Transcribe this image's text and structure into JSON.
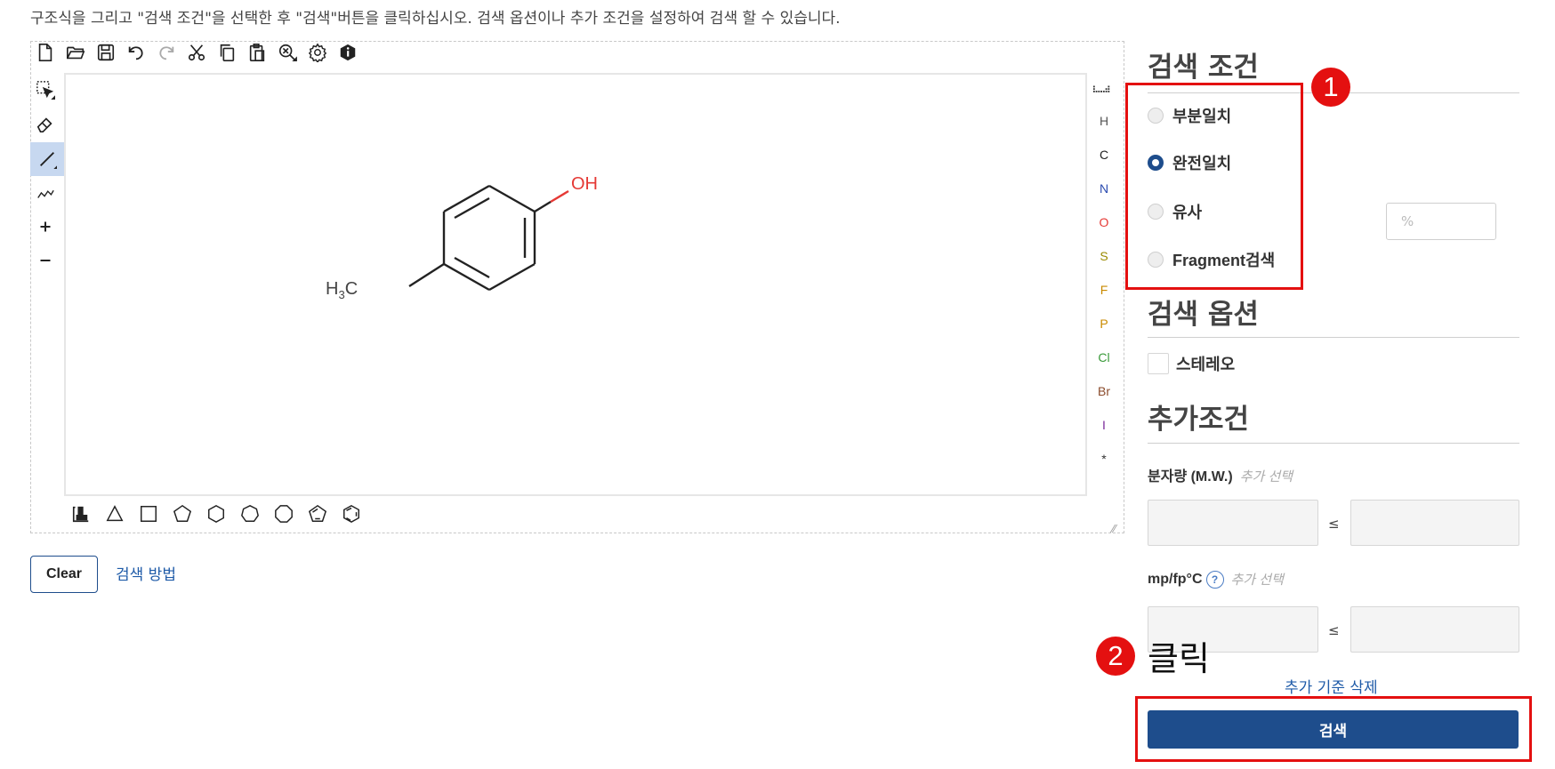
{
  "instruction": "구조식을 그리고 \"검색 조건\"을 선택한 후 \"검색\"버튼을 클릭하십시오. 검색 옵션이나 추가 조건을 설정하여 검색 할 수 있습니다.",
  "toolbar": {
    "top_icons": [
      "new-file-icon",
      "open-folder-icon",
      "save-icon",
      "undo-icon",
      "redo-icon",
      "cut-icon",
      "copy-icon",
      "paste-icon",
      "zoom-icon",
      "settings-icon",
      "info-icon"
    ],
    "left_icons": [
      "select-icon",
      "eraser-icon",
      "bond-icon",
      "chain-icon",
      "plus-icon",
      "minus-icon"
    ],
    "bottom_icons": [
      "template-icon",
      "triangle-icon",
      "square-icon",
      "pentagon-icon",
      "hexagon-icon",
      "heptagon-icon",
      "octagon-icon",
      "cyclopentadiene-icon",
      "benzene-icon"
    ]
  },
  "periodic_icon": "periodic-table-icon",
  "elements": [
    {
      "symbol": "H",
      "color": "#555555"
    },
    {
      "symbol": "C",
      "color": "#222222"
    },
    {
      "symbol": "N",
      "color": "#2b4bb0"
    },
    {
      "symbol": "O",
      "color": "#e53935"
    },
    {
      "symbol": "S",
      "color": "#9a8a00"
    },
    {
      "symbol": "F",
      "color": "#c98a00"
    },
    {
      "symbol": "P",
      "color": "#c98a00"
    },
    {
      "symbol": "Cl",
      "color": "#3a9a3a"
    },
    {
      "symbol": "Br",
      "color": "#8a4a2a"
    },
    {
      "symbol": "I",
      "color": "#7a2a9a"
    },
    {
      "symbol": "*",
      "color": "#333333"
    }
  ],
  "molecule": {
    "oh_label": "OH",
    "h_label": "H",
    "sub_label": "3",
    "c_label": "C"
  },
  "buttons": {
    "clear": "Clear",
    "help": "검색 방법",
    "search": "검색",
    "remove_criteria": "추가 기준 삭제"
  },
  "search_conditions": {
    "title": "검색 조건",
    "options": [
      {
        "label": "부분일치",
        "selected": false
      },
      {
        "label": "완전일치",
        "selected": true
      },
      {
        "label": "유사",
        "selected": false
      },
      {
        "label": "Fragment검색",
        "selected": false
      }
    ],
    "similarity_placeholder": "%"
  },
  "search_options": {
    "title": "검색 옵션",
    "stereo_label": "스테레오",
    "stereo_checked": false
  },
  "extra_conditions": {
    "title": "추가조건",
    "mw_label": "분자량 (M.W.)",
    "mw_hint": "추가 선택",
    "mp_label": "mp/fp°C",
    "mp_hint": "추가 선택",
    "le_symbol": "≤"
  },
  "annotations": {
    "step1": "1",
    "step2": "2",
    "click_text": "클릭",
    "highlight_color": "#e41010"
  },
  "colors": {
    "accent": "#1e4d8c",
    "link": "#1f5ba8",
    "oxygen": "#e53935"
  }
}
